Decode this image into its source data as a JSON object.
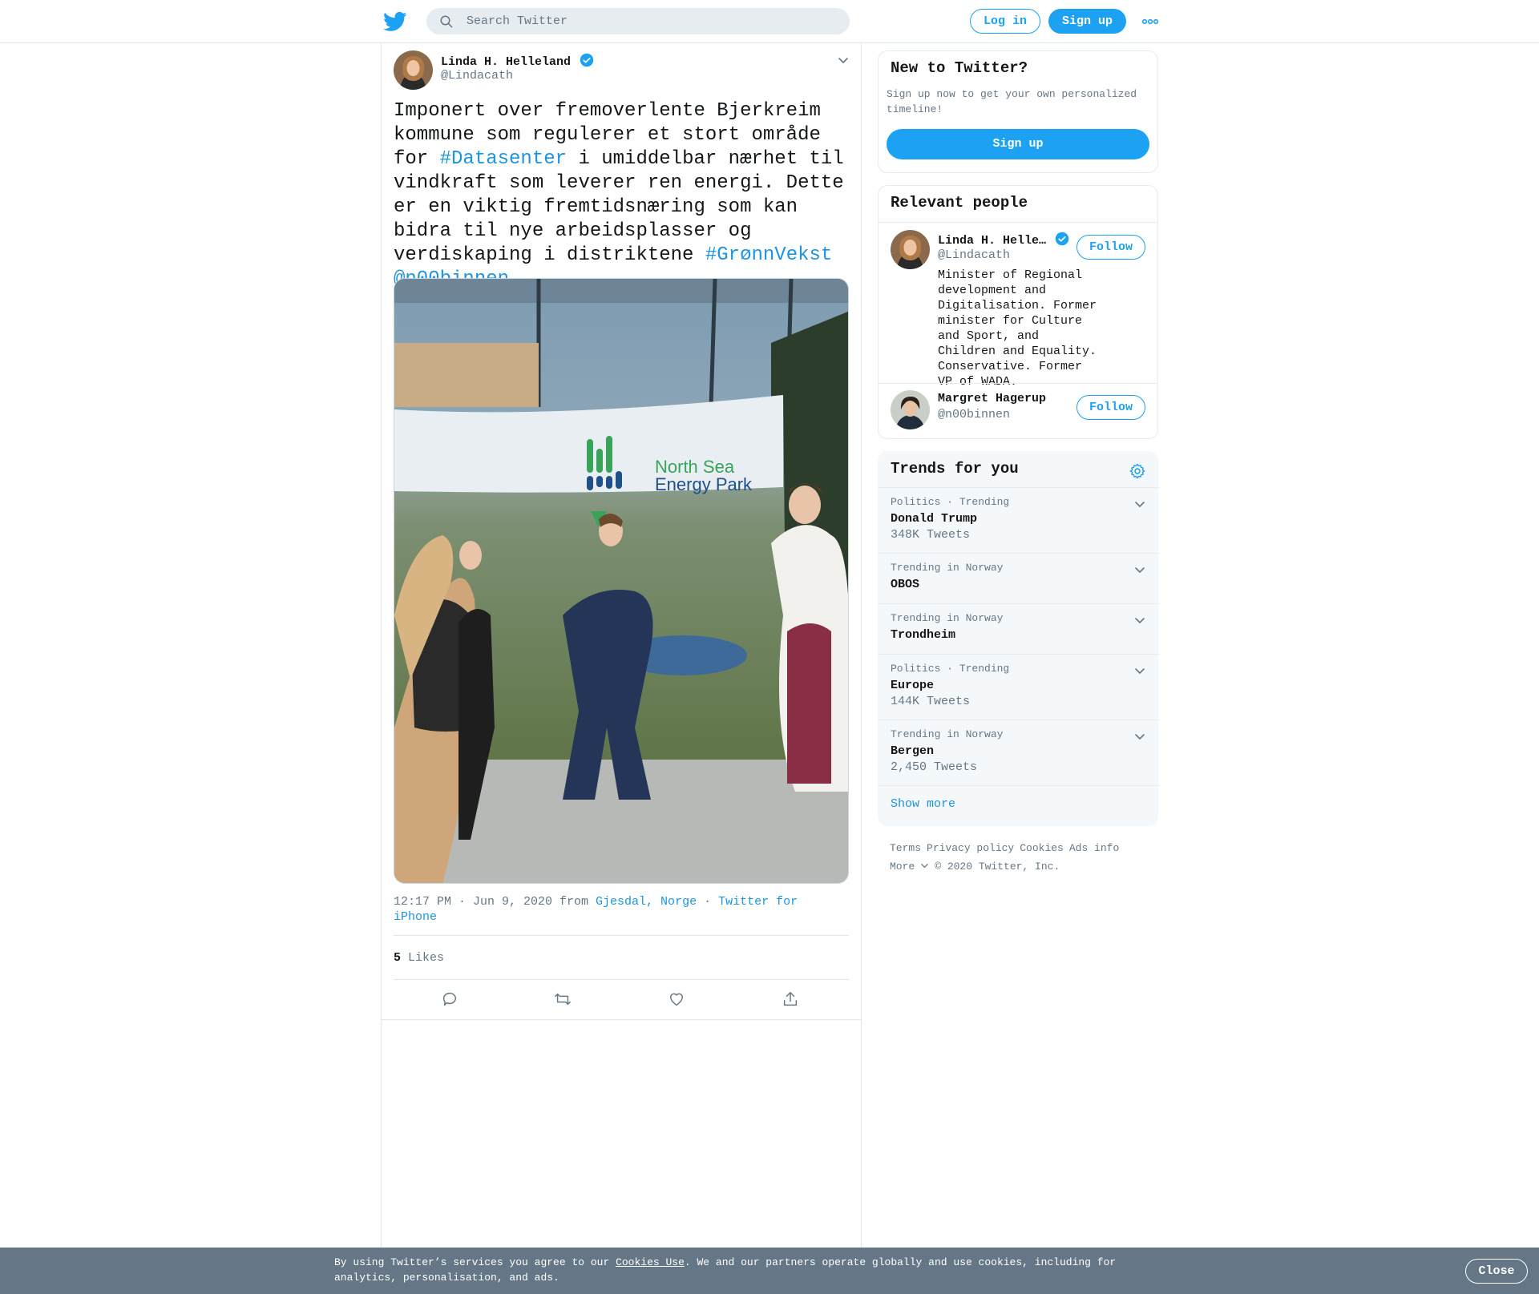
{
  "header": {
    "search_placeholder": "Search Twitter",
    "login_label": "Log in",
    "signup_label": "Sign up"
  },
  "tweet": {
    "author_name": "Linda H. Helleland",
    "author_handle": "@Lindacath",
    "text_part1": "Imponert over fremoverlente Bjerkreim kommune som regulerer et stort område for ",
    "hashtag1": "#Datasenter",
    "text_part2": " i umiddelbar nærhet til vindkraft som leverer ren energi. Dette er en viktig fremtidsnæring som kan bidra til nye arbeidsplasser og verdiskaping i distriktene ",
    "hashtag2": "#GrønnVekst",
    "mention": "@n00binnen",
    "time": "12:17 PM · Jun 9, 2020 from ",
    "location": "Gjesdal, Norge",
    "source_sep": " · ",
    "source": "Twitter for iPhone",
    "likes_count": "5",
    "likes_label": " Likes",
    "banner_title_line1": "North Sea",
    "banner_title_line2": "Energy Park"
  },
  "sidebar": {
    "new_to_twitter": {
      "title": "New to Twitter?",
      "text": "Sign up now to get your own personalized timeline!",
      "button": "Sign up"
    },
    "relevant_people": {
      "title": "Relevant people",
      "people": [
        {
          "name": "Linda H. Helle…",
          "handle": "@Lindacath",
          "bio": "Minister of Regional development and Digitalisation. Former minister for Culture and Sport, and Children and Equality. Conservative. Former VP of WADA.",
          "follow": "Follow"
        },
        {
          "name": "Margret Hagerup",
          "handle": "@n00binnen",
          "follow": "Follow"
        }
      ]
    },
    "trends": {
      "title": "Trends for you",
      "items": [
        {
          "context": "Politics · Trending",
          "name": "Donald Trump",
          "count": "348K Tweets"
        },
        {
          "context": "Trending in Norway",
          "name": "OBOS",
          "count": ""
        },
        {
          "context": "Trending in Norway",
          "name": "Trondheim",
          "count": ""
        },
        {
          "context": "Politics · Trending",
          "name": "Europe",
          "count": "144K Tweets"
        },
        {
          "context": "Trending in Norway",
          "name": "Bergen",
          "count": "2,450 Tweets"
        }
      ],
      "show_more": "Show more"
    },
    "footer": {
      "terms": "Terms",
      "privacy": "Privacy policy",
      "cookies": "Cookies",
      "ads": "Ads info",
      "more": "More",
      "copyright": "© 2020 Twitter, Inc."
    }
  },
  "cookie_bar": {
    "text_before": "By using Twitter’s services you agree to our ",
    "link": "Cookies Use",
    "text_after": ". We and our partners operate globally and use cookies, including for analytics, personalisation, and ads.",
    "close": "Close"
  },
  "colors": {
    "brand_blue": "#1da1f2",
    "link_blue": "#1b95e0",
    "secondary_text": "#657786",
    "cookie_bar_bg": "#657786"
  }
}
